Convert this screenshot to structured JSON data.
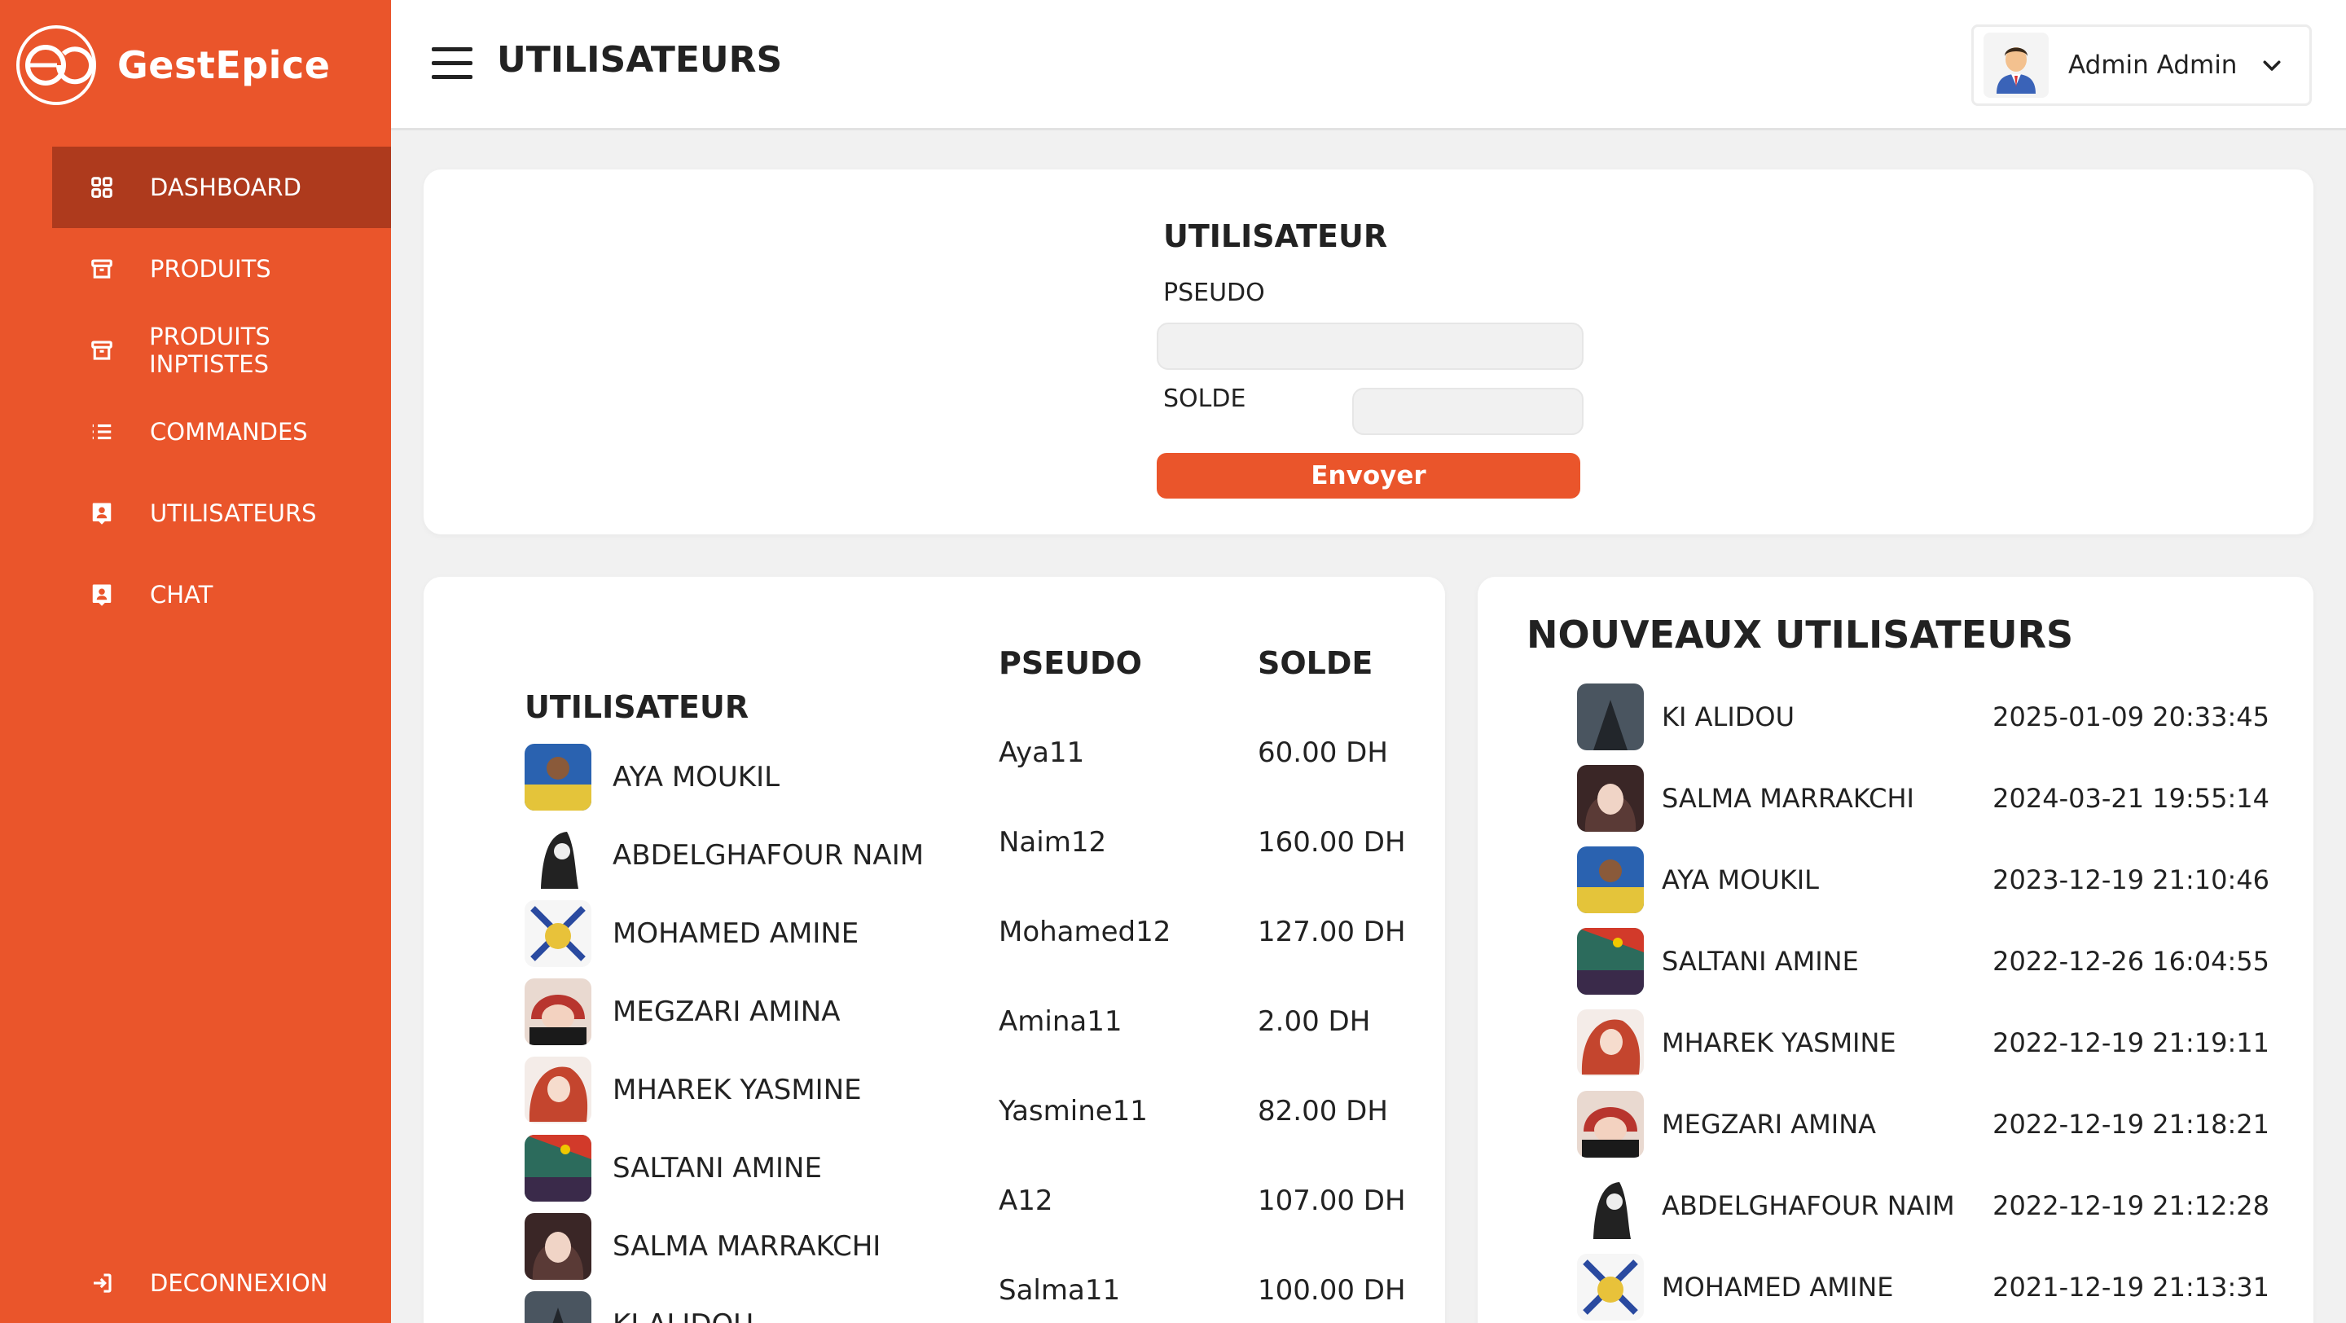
{
  "brand": {
    "name": "GestEpice",
    "logo_text": "GestEpice"
  },
  "colors": {
    "accent": "#ea552b",
    "accent_dark": "#ae3a1d"
  },
  "sidebar": {
    "items": [
      {
        "label": "DASHBOARD",
        "icon": "grid-icon",
        "active": true
      },
      {
        "label": "PRODUITS",
        "icon": "archive-icon"
      },
      {
        "label": "PRODUITS INPTISTES",
        "icon": "archive-icon"
      },
      {
        "label": "COMMANDES",
        "icon": "list-icon"
      },
      {
        "label": "UTILISATEURS",
        "icon": "user-badge-icon"
      },
      {
        "label": "CHAT",
        "icon": "user-badge-icon"
      }
    ],
    "logout": {
      "label": "DECONNEXION",
      "icon": "logout-icon"
    }
  },
  "header": {
    "title": "UTILISATEURS",
    "user": {
      "name": "Admin Admin"
    }
  },
  "form": {
    "title": "UTILISATEUR",
    "pseudo_label": "PSEUDO",
    "pseudo_value": "",
    "solde_label": "SOLDE",
    "solde_value": "",
    "submit_label": "Envoyer"
  },
  "users_table": {
    "headers": {
      "user": "UTILISATEUR",
      "pseudo": "PSEUDO",
      "solde": "SOLDE"
    },
    "rows": [
      {
        "name": "AYA MOUKIL",
        "pseudo": "Aya11",
        "solde": "60.00 DH"
      },
      {
        "name": "ABDELGHAFOUR NAIM",
        "pseudo": "Naim12",
        "solde": "160.00 DH"
      },
      {
        "name": "MOHAMED AMINE",
        "pseudo": "Mohamed12",
        "solde": "127.00 DH"
      },
      {
        "name": "MEGZARI AMINA",
        "pseudo": "Amina11",
        "solde": "2.00 DH"
      },
      {
        "name": "MHAREK YASMINE",
        "pseudo": "Yasmine11",
        "solde": "82.00 DH"
      },
      {
        "name": "SALTANI AMINE",
        "pseudo": "A12",
        "solde": "107.00 DH"
      },
      {
        "name": "SALMA MARRAKCHI",
        "pseudo": "Salma11",
        "solde": "100.00 DH"
      },
      {
        "name": "KI ALIDOU"
      }
    ]
  },
  "new_users": {
    "title": "NOUVEAUX UTILISATEURS",
    "rows": [
      {
        "name": "KI ALIDOU",
        "date": "2025-01-09 20:33:45"
      },
      {
        "name": "SALMA MARRAKCHI",
        "date": "2024-03-21 19:55:14"
      },
      {
        "name": "AYA MOUKIL",
        "date": "2023-12-19 21:10:46"
      },
      {
        "name": "SALTANI AMINE",
        "date": "2022-12-26 16:04:55"
      },
      {
        "name": "MHAREK YASMINE",
        "date": "2022-12-19 21:19:11"
      },
      {
        "name": "MEGZARI AMINA",
        "date": "2022-12-19 21:18:21"
      },
      {
        "name": "ABDELGHAFOUR NAIM",
        "date": "2022-12-19 21:12:28"
      },
      {
        "name": "MOHAMED AMINE",
        "date": "2021-12-19 21:13:31"
      }
    ]
  }
}
